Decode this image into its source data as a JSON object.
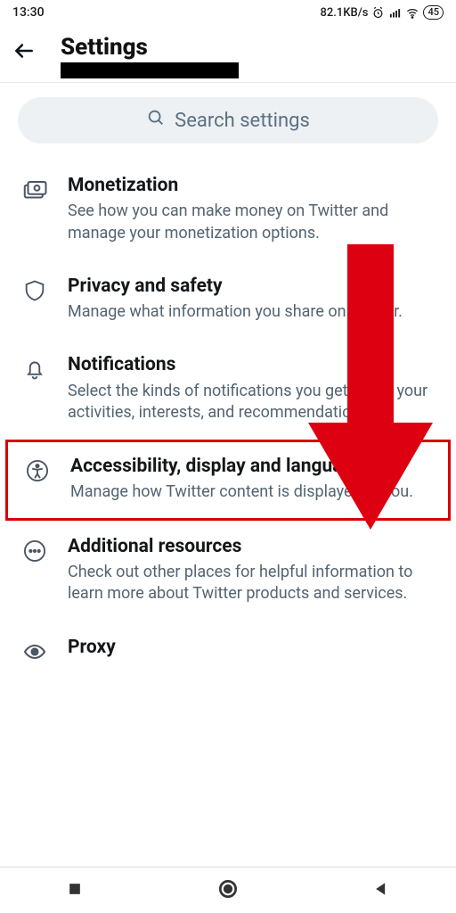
{
  "status": {
    "time": "13:30",
    "net_speed": "82.1KB/s",
    "battery": "45"
  },
  "header": {
    "title": "Settings"
  },
  "search": {
    "placeholder": "Search settings"
  },
  "items": [
    {
      "icon": "monetization",
      "title": "Monetization",
      "desc": "See how you can make money on Twitter and manage your monetization options."
    },
    {
      "icon": "shield",
      "title": "Privacy and safety",
      "desc": "Manage what information you share on Twitter."
    },
    {
      "icon": "bell",
      "title": "Notifications",
      "desc": "Select the kinds of notifications you get about your activities, interests, and recommendations."
    },
    {
      "icon": "accessibility",
      "title": "Accessibility, display and languages",
      "desc": "Manage how Twitter content is displayed to you."
    },
    {
      "icon": "more",
      "title": "Additional resources",
      "desc": "Check out other places for helpful information to learn more about Twitter products and services."
    },
    {
      "icon": "eye",
      "title": "Proxy",
      "desc": ""
    }
  ],
  "annotation": {
    "highlight_index": 3
  }
}
